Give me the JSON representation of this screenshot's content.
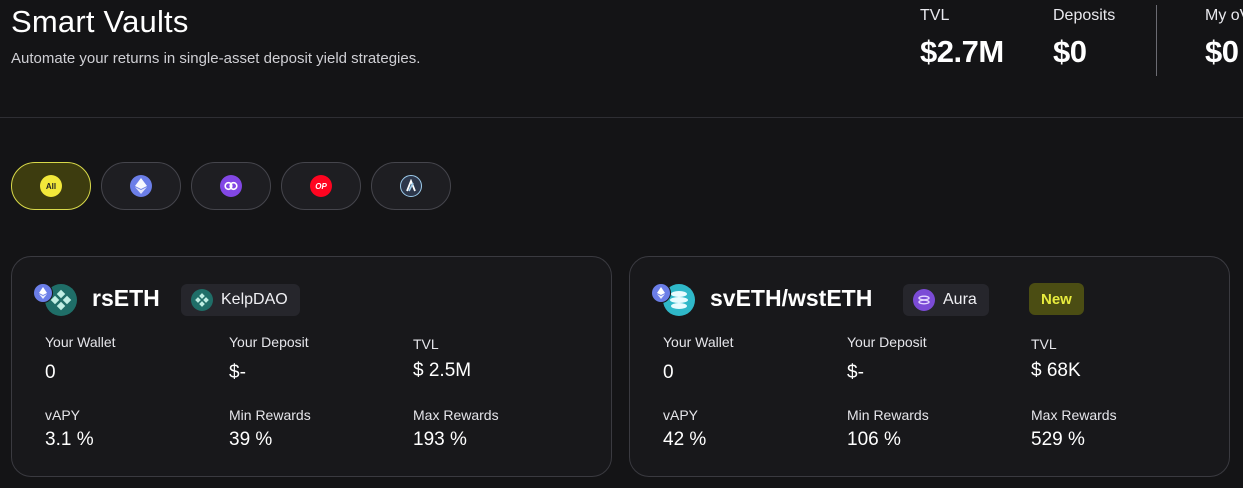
{
  "header": {
    "title": "Smart Vaults",
    "subtitle": "Automate your returns in single-asset deposit yield strategies."
  },
  "stats": {
    "tvl_label": "TVL",
    "tvl_value": "$2.7M",
    "deposits_label": "Deposits",
    "deposits_value": "$0",
    "my_label": "My oV",
    "my_value": "$0"
  },
  "filters": {
    "all_label": "All",
    "items": [
      {
        "name": "All",
        "icon": "all-icon"
      },
      {
        "name": "Ethereum",
        "icon": "ethereum-icon"
      },
      {
        "name": "Polygon",
        "icon": "polygon-icon"
      },
      {
        "name": "Optimism",
        "icon": "optimism-icon",
        "icon_text": "OP"
      },
      {
        "name": "Arbitrum",
        "icon": "arbitrum-icon"
      }
    ]
  },
  "vaults": [
    {
      "name": "rsETH",
      "protocol": "KelpDAO",
      "labels": {
        "wallet": "Your Wallet",
        "deposit": "Your Deposit",
        "tvl": "TVL",
        "vapy": "vAPY",
        "min": "Min Rewards",
        "max": "Max Rewards"
      },
      "values": {
        "wallet": "0",
        "deposit": "$-",
        "tvl": "$ 2.5M",
        "vapy": "3.1 %",
        "min": "39 %",
        "max": "193 %"
      }
    },
    {
      "name": "svETH/wstETH",
      "protocol": "Aura",
      "badge": "New",
      "labels": {
        "wallet": "Your Wallet",
        "deposit": "Your Deposit",
        "tvl": "TVL",
        "vapy": "vAPY",
        "min": "Min Rewards",
        "max": "Max Rewards"
      },
      "values": {
        "wallet": "0",
        "deposit": "$-",
        "tvl": "$ 68K",
        "vapy": "42 %",
        "min": "106 %",
        "max": "529 %"
      }
    }
  ],
  "colors": {
    "background": "#141416",
    "accent_yellow": "#e8ec3e",
    "card_border": "#3a3a40"
  }
}
